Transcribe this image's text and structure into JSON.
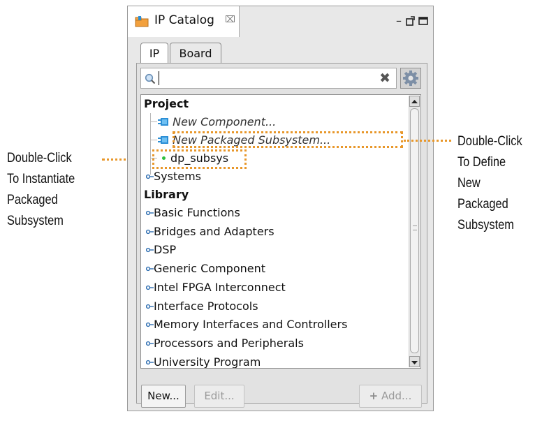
{
  "panel": {
    "title": "IP Catalog",
    "title_close_glyph": "⌧",
    "window_controls": {
      "minimize": "–",
      "restore": "⧉",
      "maximize": "▭"
    }
  },
  "tabs": [
    {
      "label": "IP",
      "active": true
    },
    {
      "label": "Board",
      "active": false
    }
  ],
  "search": {
    "value": "",
    "placeholder": ""
  },
  "tree": {
    "project_header": "Project",
    "project_items": [
      {
        "label": "New Component...",
        "icon": "component-icon",
        "italic": true
      },
      {
        "label": "New Packaged Subsystem...",
        "icon": "component-icon",
        "italic": true
      },
      {
        "label": "dp_subsys",
        "icon": "green-dot-icon",
        "italic": false
      },
      {
        "label": "Systems",
        "icon": "collapse-icon",
        "italic": false
      }
    ],
    "library_header": "Library",
    "library_items": [
      "Basic Functions",
      "Bridges and Adapters",
      "DSP",
      "Generic Component",
      "Intel FPGA Interconnect",
      "Interface Protocols",
      "Memory Interfaces and Controllers",
      "Processors and Peripherals",
      "University Program"
    ]
  },
  "buttons": {
    "new": "New...",
    "edit": "Edit...",
    "add": "Add...",
    "add_icon": "+"
  },
  "callouts": {
    "left": [
      "Double-Click",
      "To Instantiate",
      "Packaged",
      "Subsystem"
    ],
    "right": [
      "Double-Click",
      "To Define New",
      "Packaged",
      "Subsystem"
    ]
  },
  "colors": {
    "highlight": "#e8972a",
    "dot": "#2fbf3f",
    "icon_blue": "#2c8fd6"
  }
}
